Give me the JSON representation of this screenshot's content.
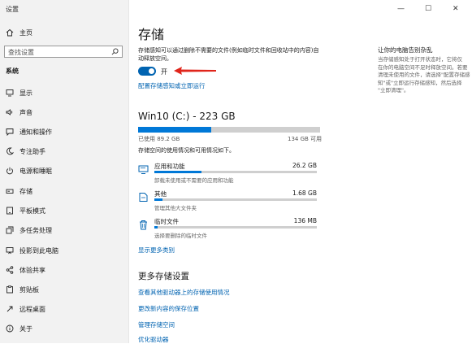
{
  "window": {
    "title": "设置",
    "controls": [
      "—",
      "☐",
      "✕"
    ]
  },
  "sidebar": {
    "home_label": "主页",
    "search_placeholder": "查找设置",
    "section_label": "系统",
    "items": [
      {
        "label": "显示",
        "icon": "display-icon"
      },
      {
        "label": "声音",
        "icon": "sound-icon"
      },
      {
        "label": "通知和操作",
        "icon": "notification-icon"
      },
      {
        "label": "专注助手",
        "icon": "moon-icon"
      },
      {
        "label": "电源和睡眠",
        "icon": "power-icon"
      },
      {
        "label": "存储",
        "icon": "storage-icon"
      },
      {
        "label": "平板模式",
        "icon": "tablet-icon"
      },
      {
        "label": "多任务处理",
        "icon": "multitask-icon"
      },
      {
        "label": "投影到此电脑",
        "icon": "projector-icon"
      },
      {
        "label": "体验共享",
        "icon": "share-icon"
      },
      {
        "label": "剪贴板",
        "icon": "clipboard-icon"
      },
      {
        "label": "远程桌面",
        "icon": "remote-icon"
      },
      {
        "label": "关于",
        "icon": "info-icon"
      }
    ]
  },
  "main": {
    "title": "存储",
    "description": "存储感知可以通过删除不需要的文件(例如临时文件和回收站中的内容)自动释放空间。",
    "toggle_label": "开",
    "toggle_on": true,
    "configure_link": "配置存储感知或立即运行",
    "drive": {
      "title": "Win10 (C:) - 223 GB",
      "used_label": "已使用 89.2 GB",
      "free_label": "134 GB 可用",
      "used_fraction": 0.4,
      "usage_desc": "存储空间的使用情况和可用情况如下。"
    },
    "categories": [
      {
        "name": "应用和功能",
        "size": "26.2 GB",
        "desc": "卸载未使用或不需要的应用和功能",
        "fraction": 0.29,
        "icon": "apps-icon"
      },
      {
        "name": "其他",
        "size": "1.68 GB",
        "desc": "管理其他大文件夹",
        "fraction": 0.05,
        "icon": "folder-icon"
      },
      {
        "name": "临时文件",
        "size": "136 MB",
        "desc": "选择要删除的临时文件",
        "fraction": 0.02,
        "icon": "trash-icon"
      }
    ],
    "show_more_link": "显示更多类别",
    "more_title": "更多存储设置",
    "more_links": [
      "查看其他驱动器上的存储使用情况",
      "更改新内容的保存位置",
      "管理存储空间",
      "优化驱动器"
    ]
  },
  "side_panel": {
    "title": "让你的电脑告别杂乱",
    "lines": [
      "当存储感知处于打开状态时，它将仅",
      "在你的电脑空间不足时释放空间。若要",
      "清理未使用的文件，请选择\"配置存储感",
      "知\"或\"立即运行存储感知，然后选择",
      "\"立即清理\"。"
    ]
  },
  "colors": {
    "accent": "#0063b1",
    "bar_fill": "#0078d7",
    "annotation": "#e0251b"
  }
}
